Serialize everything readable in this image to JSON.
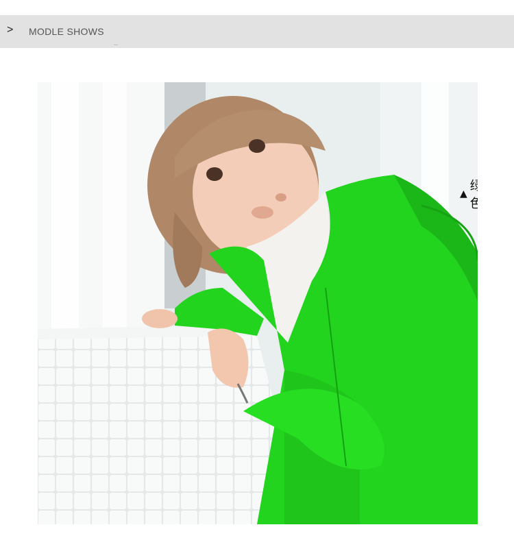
{
  "header": {
    "chevron": ">",
    "title": "MODLE SHOWS"
  },
  "photo": {
    "caption_marker": "▲",
    "caption": "绿色",
    "jacket_color": "#22d41e"
  }
}
